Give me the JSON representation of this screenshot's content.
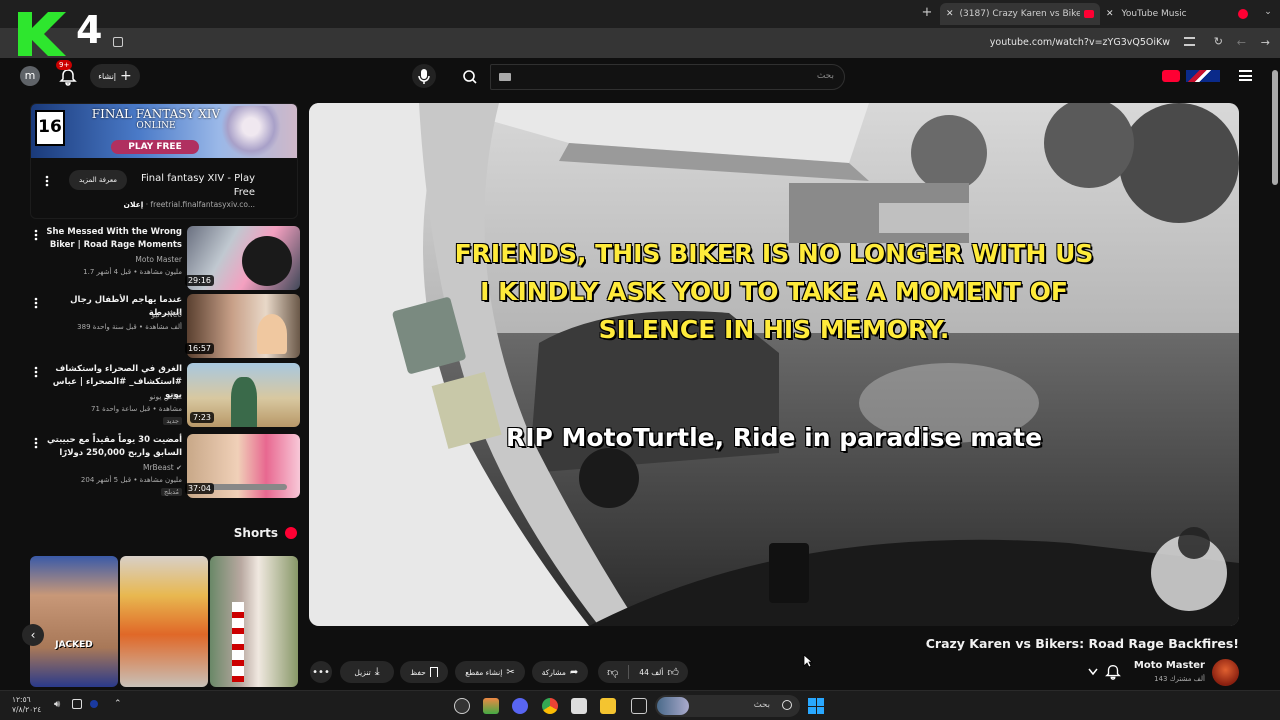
{
  "browser": {
    "tabs": [
      {
        "label": "(3187) Crazy Karen vs Bikers: R"
      },
      {
        "label": "YouTube Music"
      }
    ],
    "url": "youtube.com/watch?v=zYG3vQ5OiKw"
  },
  "youtube": {
    "search_placeholder": "بحث",
    "create_label": "إنشاء",
    "notifications_count": "9+",
    "avatar_letter": "m"
  },
  "ad": {
    "age_rating": "16",
    "banner_title": "FINAL FANTASY XIV",
    "banner_subtitle": "ONLINE",
    "banner_button": "PLAY FREE",
    "title": "Final fantasy XIV - Play Free",
    "label": "إعلان",
    "url": "freetrial.finalfantasyxiv.co...",
    "more_button": "معرفة المزيد"
  },
  "related": [
    {
      "title": "She Messed With the Wrong Biker | Road Rage Moments",
      "channel": "Moto Master",
      "meta": "1.7 مليون مشاهدة • قبل 4 أشهر",
      "duration": "29:16"
    },
    {
      "title": "عندما يهاجم الأطفال رجال الشرطة",
      "channel": "نيو - Neo",
      "meta": "389 ألف مشاهدة • قبل سنة واحدة",
      "duration": "16:57"
    },
    {
      "title": "الغرق في الصحراء واستكشاف #استكشاف_ #الصحراء | عباس يونو",
      "channel": "عباس يونو",
      "meta": "71 مشاهدة • قبل ساعة واحدة",
      "badge": "جديد",
      "duration": "7:23"
    },
    {
      "title": "أمضيت 30 يوماً مقيداً مع حبيبتي السابق واربح 250,000 دولارًا",
      "channel": "MrBeast",
      "meta": "204 مليون مشاهدة • قبل 5 أشهر",
      "badge": "مُدبلج",
      "duration": "37:04"
    }
  ],
  "shorts": {
    "label": "Shorts",
    "items": [
      {
        "caption": "JACKED"
      },
      {
        "caption": ""
      },
      {
        "caption": ""
      }
    ]
  },
  "video": {
    "subtitle_main": "FRIENDS, THIS BIKER IS NO LONGER WITH US\nI KINDLY ASK YOU TO TAKE A MOMENT OF\nSILENCE IN HIS MEMORY.",
    "subtitle_rip": "RIP MotoTurtle, Ride in paradise mate",
    "title": "Crazy Karen vs Bikers: Road Rage Backfires!",
    "channel": "Moto Master",
    "subscribers": "143 ألف مشترك",
    "likes": "44 ألف",
    "share_label": "مشاركة",
    "clip_label": "إنشاء مقطع",
    "save_label": "حفظ",
    "download_label": "تنزيل"
  },
  "taskbar": {
    "time": "١٢:٥٦",
    "date": "٧/٨/٢٠٢٤",
    "search_label": "بحث"
  },
  "logo": {
    "text": "4"
  }
}
